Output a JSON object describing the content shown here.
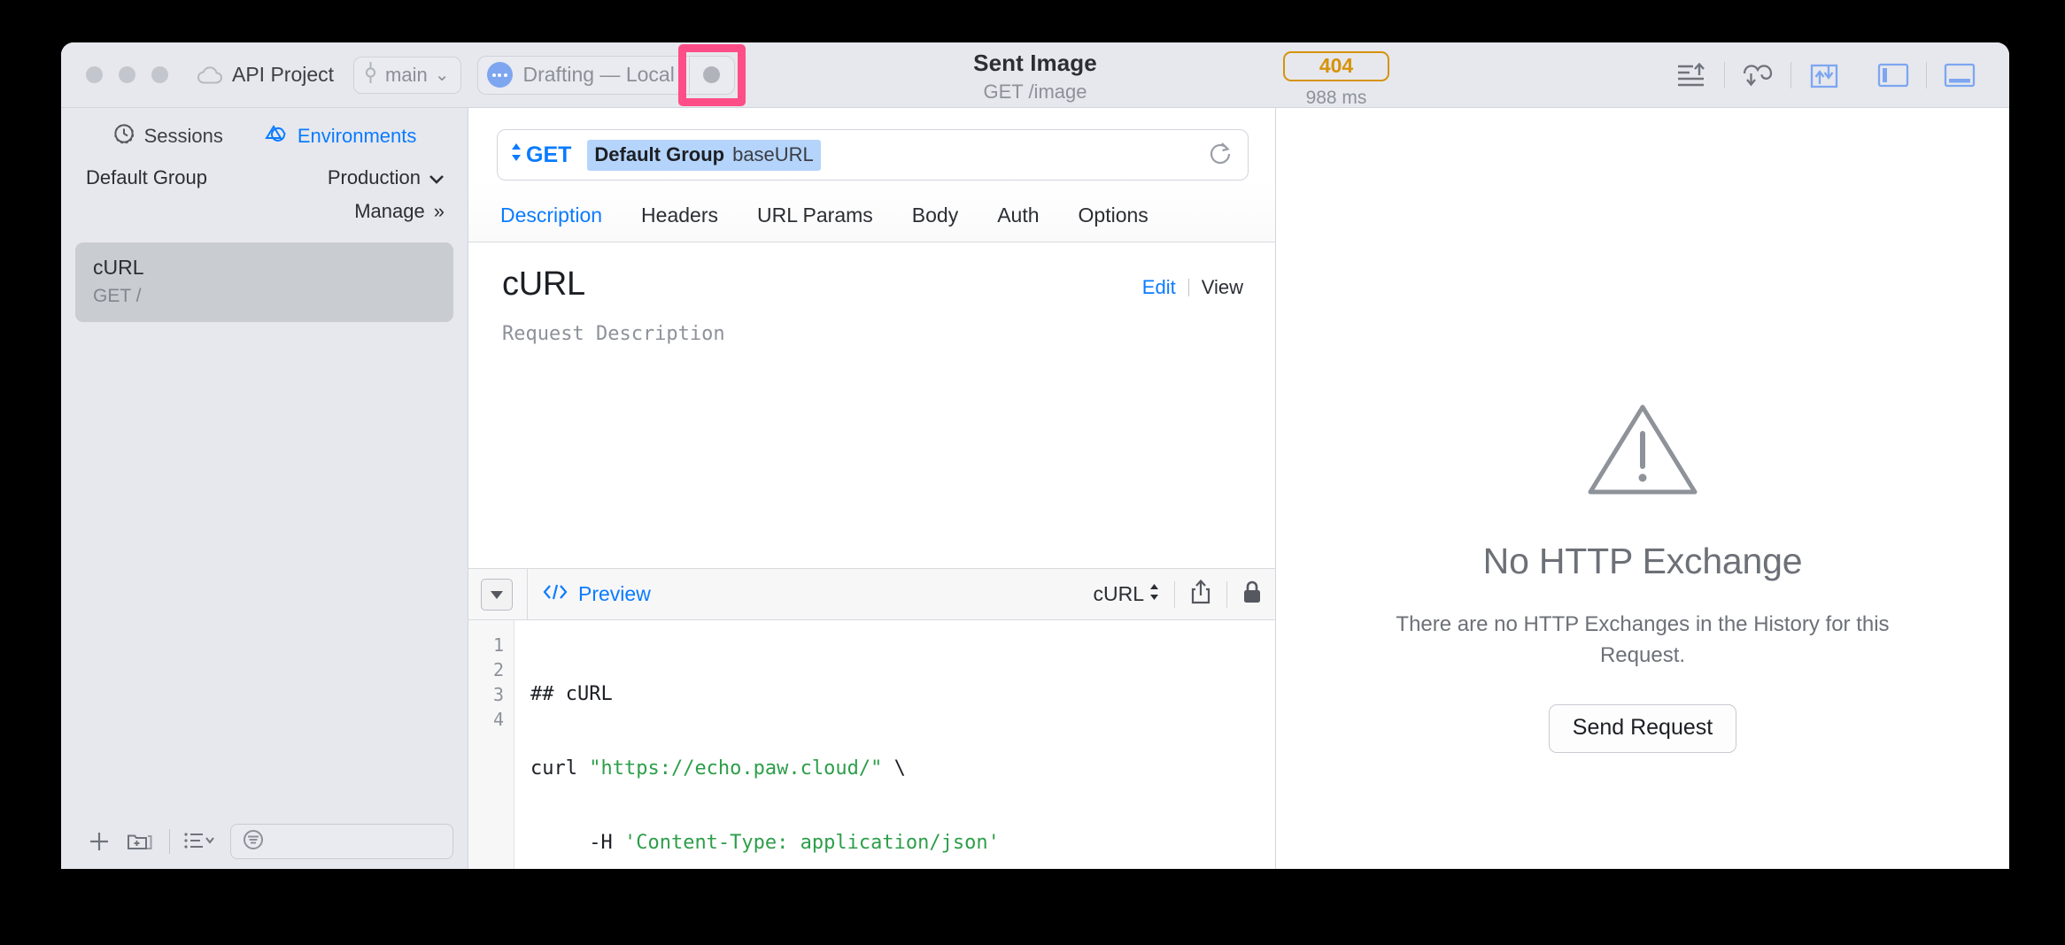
{
  "window": {
    "traffic_lights": [
      "close",
      "minimize",
      "zoom"
    ]
  },
  "toolbar": {
    "project_name": "API Project",
    "project_icon": "cloud-icon",
    "branch_name": "main",
    "branch_icon": "git-branch-icon",
    "branch_chevron": "⌄",
    "environment_label": "Drafting — Local",
    "environment_icon": "three-dots-circle-icon",
    "record_icon": "record-dot-icon",
    "title": "Sent Image",
    "subtitle": "GET /image",
    "status_code": "404",
    "status_time": "988 ms",
    "status_color": "#d6930b",
    "highlight_color": "#ff4d87",
    "right_icons": [
      {
        "name": "send-request-icon"
      },
      {
        "name": "code-generator-icon"
      },
      {
        "name": "import-export-icon"
      },
      {
        "name": "toggle-left-sidebar-icon"
      },
      {
        "name": "toggle-bottom-panel-icon"
      }
    ]
  },
  "sidebar": {
    "tabs": [
      {
        "label": "Sessions",
        "icon": "clock-history-icon",
        "active": false
      },
      {
        "label": "Environments",
        "icon": "environments-icon",
        "active": true
      }
    ],
    "group_label": "Default Group",
    "environment_selected": "Production",
    "environment_chevron": "⌄",
    "manage_label": "Manage",
    "manage_chevron": "»",
    "requests": [
      {
        "name": "cURL",
        "method_path": "GET /",
        "selected": true
      }
    ],
    "bottom_bar": {
      "add_icon": "plus-icon",
      "new_folder_icon": "new-folder-icon",
      "list_icon": "list-options-icon",
      "list_chevron": "⌄",
      "filter_icon": "filter-icon",
      "filter_value": "",
      "filter_placeholder": ""
    }
  },
  "request": {
    "method": "GET",
    "method_stepper_icon": "up-down-stepper-icon",
    "url_token_group": "Default Group",
    "url_token_variable": "baseURL",
    "reload_icon": "reload-icon",
    "tabs": [
      {
        "label": "Description",
        "active": true
      },
      {
        "label": "Headers",
        "active": false
      },
      {
        "label": "URL Params",
        "active": false
      },
      {
        "label": "Body",
        "active": false
      },
      {
        "label": "Auth",
        "active": false
      },
      {
        "label": "Options",
        "active": false
      }
    ],
    "description": {
      "title": "cURL",
      "placeholder": "Request Description",
      "edit_label": "Edit",
      "view_label": "View"
    }
  },
  "code_panel": {
    "disclosure_icon": "disclosure-triangle-icon",
    "preview_label": "Preview",
    "preview_icon": "code-brackets-icon",
    "language": "cURL",
    "language_stepper_icon": "up-down-stepper-icon",
    "share_icon": "share-icon",
    "lock_icon": "lock-icon",
    "line_numbers": [
      "1",
      "2",
      "3",
      "4"
    ],
    "lines": [
      {
        "segments": [
          {
            "text": "## cURL",
            "style": "plain"
          }
        ]
      },
      {
        "segments": [
          {
            "text": "curl ",
            "style": "plain"
          },
          {
            "text": "\"https://echo.paw.cloud/\"",
            "style": "string"
          },
          {
            "text": " \\",
            "style": "plain"
          }
        ]
      },
      {
        "segments": [
          {
            "text": "     -H ",
            "style": "plain"
          },
          {
            "text": "'Content-Type: application/json'",
            "style": "string"
          }
        ]
      },
      {
        "segments": [
          {
            "text": "",
            "style": "plain"
          }
        ]
      }
    ],
    "string_color": "#2d9e4a"
  },
  "response_panel": {
    "icon": "warning-triangle-icon",
    "title": "No HTTP Exchange",
    "message": "There are no HTTP Exchanges in the History for this Request.",
    "button_label": "Send Request"
  }
}
